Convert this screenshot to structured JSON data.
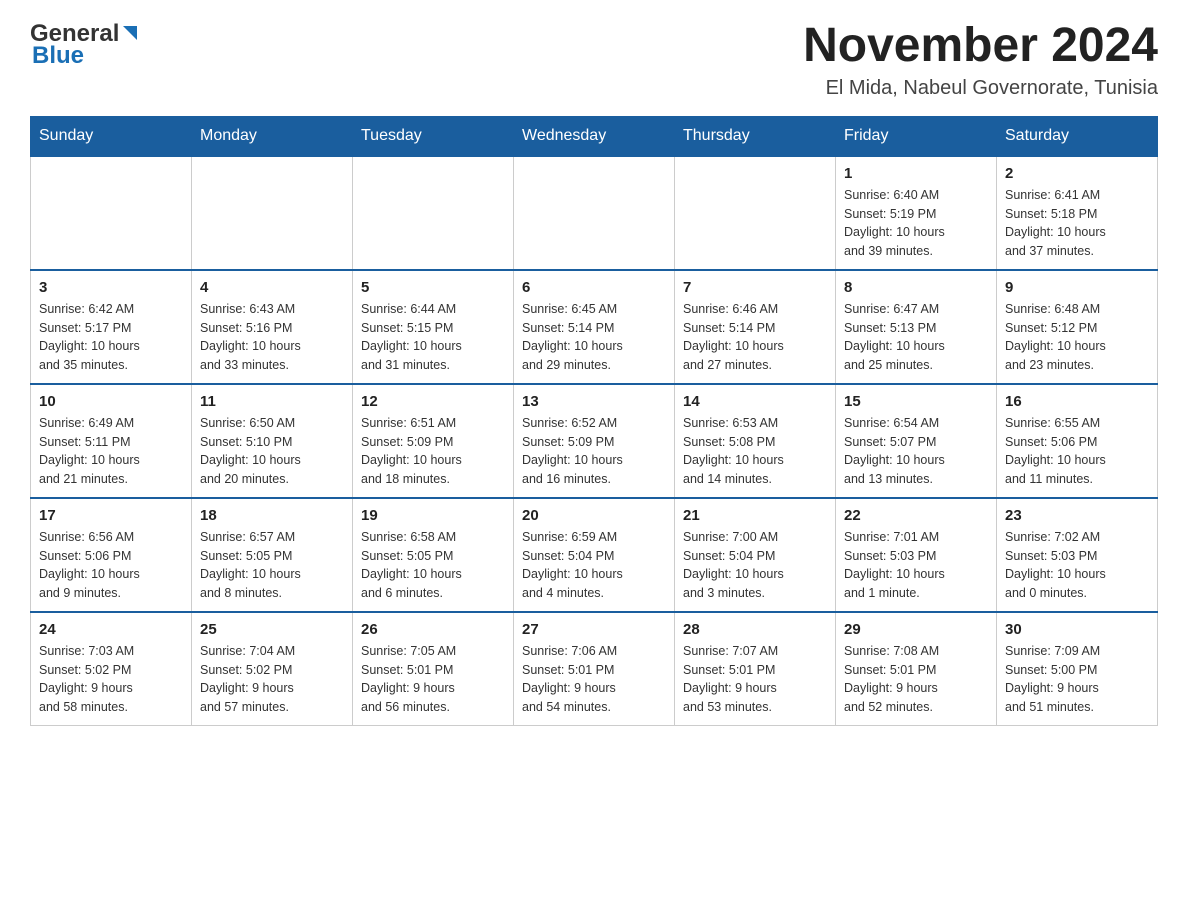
{
  "header": {
    "logo": {
      "general": "General",
      "blue": "Blue"
    },
    "title": "November 2024",
    "location": "El Mida, Nabeul Governorate, Tunisia"
  },
  "weekdays": [
    "Sunday",
    "Monday",
    "Tuesday",
    "Wednesday",
    "Thursday",
    "Friday",
    "Saturday"
  ],
  "weeks": [
    [
      {
        "day": "",
        "info": ""
      },
      {
        "day": "",
        "info": ""
      },
      {
        "day": "",
        "info": ""
      },
      {
        "day": "",
        "info": ""
      },
      {
        "day": "",
        "info": ""
      },
      {
        "day": "1",
        "info": "Sunrise: 6:40 AM\nSunset: 5:19 PM\nDaylight: 10 hours\nand 39 minutes."
      },
      {
        "day": "2",
        "info": "Sunrise: 6:41 AM\nSunset: 5:18 PM\nDaylight: 10 hours\nand 37 minutes."
      }
    ],
    [
      {
        "day": "3",
        "info": "Sunrise: 6:42 AM\nSunset: 5:17 PM\nDaylight: 10 hours\nand 35 minutes."
      },
      {
        "day": "4",
        "info": "Sunrise: 6:43 AM\nSunset: 5:16 PM\nDaylight: 10 hours\nand 33 minutes."
      },
      {
        "day": "5",
        "info": "Sunrise: 6:44 AM\nSunset: 5:15 PM\nDaylight: 10 hours\nand 31 minutes."
      },
      {
        "day": "6",
        "info": "Sunrise: 6:45 AM\nSunset: 5:14 PM\nDaylight: 10 hours\nand 29 minutes."
      },
      {
        "day": "7",
        "info": "Sunrise: 6:46 AM\nSunset: 5:14 PM\nDaylight: 10 hours\nand 27 minutes."
      },
      {
        "day": "8",
        "info": "Sunrise: 6:47 AM\nSunset: 5:13 PM\nDaylight: 10 hours\nand 25 minutes."
      },
      {
        "day": "9",
        "info": "Sunrise: 6:48 AM\nSunset: 5:12 PM\nDaylight: 10 hours\nand 23 minutes."
      }
    ],
    [
      {
        "day": "10",
        "info": "Sunrise: 6:49 AM\nSunset: 5:11 PM\nDaylight: 10 hours\nand 21 minutes."
      },
      {
        "day": "11",
        "info": "Sunrise: 6:50 AM\nSunset: 5:10 PM\nDaylight: 10 hours\nand 20 minutes."
      },
      {
        "day": "12",
        "info": "Sunrise: 6:51 AM\nSunset: 5:09 PM\nDaylight: 10 hours\nand 18 minutes."
      },
      {
        "day": "13",
        "info": "Sunrise: 6:52 AM\nSunset: 5:09 PM\nDaylight: 10 hours\nand 16 minutes."
      },
      {
        "day": "14",
        "info": "Sunrise: 6:53 AM\nSunset: 5:08 PM\nDaylight: 10 hours\nand 14 minutes."
      },
      {
        "day": "15",
        "info": "Sunrise: 6:54 AM\nSunset: 5:07 PM\nDaylight: 10 hours\nand 13 minutes."
      },
      {
        "day": "16",
        "info": "Sunrise: 6:55 AM\nSunset: 5:06 PM\nDaylight: 10 hours\nand 11 minutes."
      }
    ],
    [
      {
        "day": "17",
        "info": "Sunrise: 6:56 AM\nSunset: 5:06 PM\nDaylight: 10 hours\nand 9 minutes."
      },
      {
        "day": "18",
        "info": "Sunrise: 6:57 AM\nSunset: 5:05 PM\nDaylight: 10 hours\nand 8 minutes."
      },
      {
        "day": "19",
        "info": "Sunrise: 6:58 AM\nSunset: 5:05 PM\nDaylight: 10 hours\nand 6 minutes."
      },
      {
        "day": "20",
        "info": "Sunrise: 6:59 AM\nSunset: 5:04 PM\nDaylight: 10 hours\nand 4 minutes."
      },
      {
        "day": "21",
        "info": "Sunrise: 7:00 AM\nSunset: 5:04 PM\nDaylight: 10 hours\nand 3 minutes."
      },
      {
        "day": "22",
        "info": "Sunrise: 7:01 AM\nSunset: 5:03 PM\nDaylight: 10 hours\nand 1 minute."
      },
      {
        "day": "23",
        "info": "Sunrise: 7:02 AM\nSunset: 5:03 PM\nDaylight: 10 hours\nand 0 minutes."
      }
    ],
    [
      {
        "day": "24",
        "info": "Sunrise: 7:03 AM\nSunset: 5:02 PM\nDaylight: 9 hours\nand 58 minutes."
      },
      {
        "day": "25",
        "info": "Sunrise: 7:04 AM\nSunset: 5:02 PM\nDaylight: 9 hours\nand 57 minutes."
      },
      {
        "day": "26",
        "info": "Sunrise: 7:05 AM\nSunset: 5:01 PM\nDaylight: 9 hours\nand 56 minutes."
      },
      {
        "day": "27",
        "info": "Sunrise: 7:06 AM\nSunset: 5:01 PM\nDaylight: 9 hours\nand 54 minutes."
      },
      {
        "day": "28",
        "info": "Sunrise: 7:07 AM\nSunset: 5:01 PM\nDaylight: 9 hours\nand 53 minutes."
      },
      {
        "day": "29",
        "info": "Sunrise: 7:08 AM\nSunset: 5:01 PM\nDaylight: 9 hours\nand 52 minutes."
      },
      {
        "day": "30",
        "info": "Sunrise: 7:09 AM\nSunset: 5:00 PM\nDaylight: 9 hours\nand 51 minutes."
      }
    ]
  ]
}
